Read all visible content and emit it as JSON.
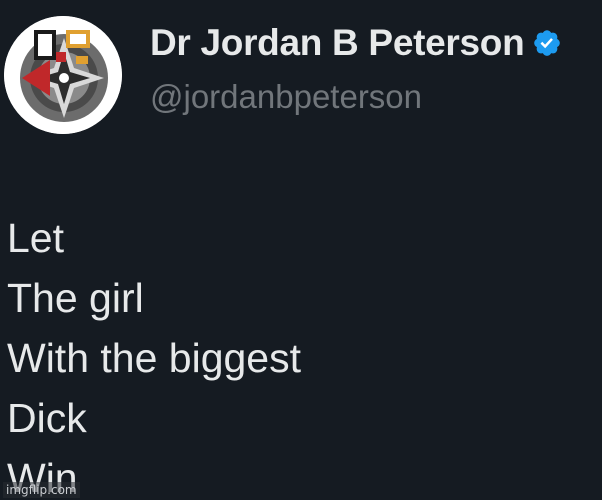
{
  "tweet": {
    "author": {
      "display_name": "Dr Jordan B Peterson",
      "handle": "@jordanbpeterson",
      "verified": true,
      "avatar_icon": "profile-emblem-icon"
    },
    "lines": [
      "Let",
      "The girl",
      "With the biggest",
      "Dick",
      "Win"
    ]
  },
  "watermark": "imgflip.com",
  "colors": {
    "background": "#151b22",
    "text": "#e7e9ea",
    "secondary_text": "#71767b",
    "verified_badge": "#1d9bf0"
  }
}
